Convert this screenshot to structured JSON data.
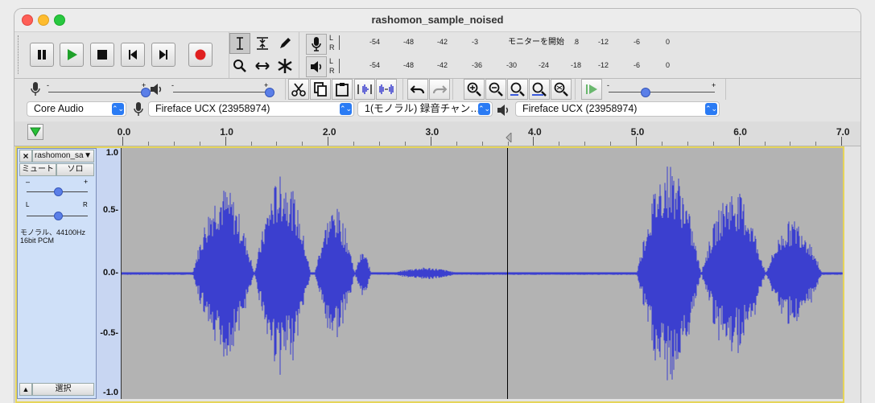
{
  "window": {
    "title": "rashomon_sample_noised"
  },
  "transport": {
    "buttons": [
      {
        "name": "pause-button",
        "icon": "pause-icon"
      },
      {
        "name": "play-button",
        "icon": "play-icon"
      },
      {
        "name": "stop-button",
        "icon": "stop-icon"
      },
      {
        "name": "skip-start-button",
        "icon": "skip-to-start-icon"
      },
      {
        "name": "skip-end-button",
        "icon": "skip-to-end-icon"
      },
      {
        "name": "record-button",
        "icon": "record-icon"
      }
    ]
  },
  "meters": {
    "record_scale": [
      "-54",
      "-48",
      "-42",
      "-3",
      "モニターを開始",
      "18",
      "-12",
      "-6",
      "0"
    ],
    "record_monitor_label": "モニターを開始",
    "playback_scale": [
      "-54",
      "-48",
      "-42",
      "-36",
      "-30",
      "-24",
      "-18",
      "-12",
      "-6",
      "0"
    ],
    "L": "L",
    "R": "R"
  },
  "devices": {
    "host": "Core Audio",
    "recording_device": "Fireface UCX (23958974)",
    "channels": "1(モノラル) 録音チャン…",
    "playback_device": "Fireface UCX (23958974)"
  },
  "ruler": {
    "ticks": [
      "0.0",
      "1.0",
      "2.0",
      "3.0",
      "4.0",
      "5.0",
      "6.0",
      "7.0"
    ]
  },
  "track": {
    "name": "rashomon_sa",
    "mute": "ミュート",
    "solo": "ソロ",
    "gain_minus": "–",
    "gain_plus": "+",
    "pan_left": "L",
    "pan_right": "R",
    "info_line1": "モノラル、44100Hz",
    "info_line2": "16bit PCM",
    "select": "選択",
    "close": "×",
    "collapse": "▲",
    "dropdown": "▼"
  },
  "yaxis": {
    "labels": [
      "1.0",
      "0.5-",
      "0.0-",
      "-0.5-",
      "-1.0"
    ]
  },
  "colors": {
    "waveform": "#3b3fcf",
    "track_bg": "#b3b3b3",
    "record_red": "#e02020",
    "play_green": "#1fa12a"
  }
}
